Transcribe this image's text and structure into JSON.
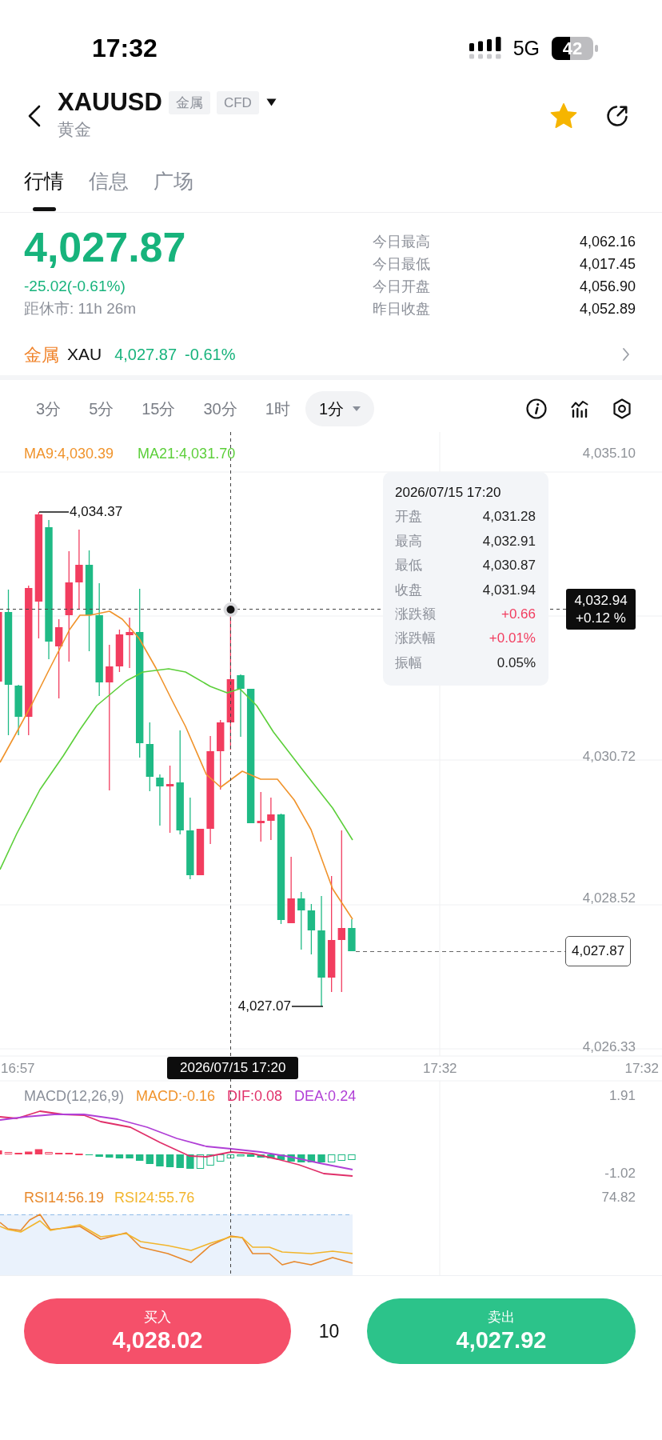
{
  "status_bar": {
    "time": "17:32",
    "network": "5G",
    "battery": "42"
  },
  "header": {
    "symbol": "XAUUSD",
    "tags": [
      "金属",
      "CFD"
    ],
    "name": "黄金",
    "favorite": true
  },
  "tabs": [
    {
      "label": "行情",
      "selected": true
    },
    {
      "label": "信息",
      "selected": false
    },
    {
      "label": "广场",
      "selected": false
    }
  ],
  "quote": {
    "price": "4,027.87",
    "change": "-25.02(-0.61%)",
    "rising": false,
    "countdown": "距休市: 11h 26m",
    "stats": [
      {
        "label": "今日最高",
        "value": "4,062.16"
      },
      {
        "label": "今日最低",
        "value": "4,017.45"
      },
      {
        "label": "今日开盘",
        "value": "4,056.90"
      },
      {
        "label": "昨日收盘",
        "value": "4,052.89"
      }
    ]
  },
  "sector": {
    "category": "金属",
    "symbol": "XAU",
    "price": "4,027.87",
    "change": "-0.61%",
    "rising": false
  },
  "intervals": [
    {
      "label": "3分",
      "selected": false
    },
    {
      "label": "5分",
      "selected": false
    },
    {
      "label": "15分",
      "selected": false
    },
    {
      "label": "30分",
      "selected": false
    },
    {
      "label": "1时",
      "selected": false
    },
    {
      "label": "1分",
      "selected": true
    }
  ],
  "chart": {
    "ma_legend": [
      {
        "label": "MA9:4,030.39",
        "color": "#f0932b"
      },
      {
        "label": "MA21:4,031.70",
        "color": "#5ccf3a"
      }
    ],
    "price_axis": [
      "4,035.10",
      "4,030.72",
      "4,028.52",
      "4,026.33"
    ],
    "high_label": "4,034.37",
    "low_label": "4,027.07",
    "last_price": "4,027.87",
    "crosshair": {
      "price": "4,032.94",
      "change": "+0.12 %",
      "time": "2026/07/15 17:20"
    },
    "tooltip": {
      "date": "2026/07/15 17:20",
      "rows": [
        {
          "label": "开盘",
          "value": "4,031.28",
          "color": "#222222"
        },
        {
          "label": "最高",
          "value": "4,032.91",
          "color": "#222222"
        },
        {
          "label": "最低",
          "value": "4,030.87",
          "color": "#222222"
        },
        {
          "label": "收盘",
          "value": "4,031.94",
          "color": "#222222"
        },
        {
          "label": "涨跌额",
          "value": "+0.66",
          "color": "#f23d5f"
        },
        {
          "label": "涨跌幅",
          "value": "+0.01%",
          "color": "#f23d5f"
        },
        {
          "label": "振幅",
          "value": "0.05%",
          "color": "#222222"
        }
      ]
    },
    "time_axis": [
      "16:57",
      "17:32",
      "17:32"
    ]
  },
  "macd": {
    "legend": [
      {
        "label": "MACD(12,26,9)",
        "color": "#8a8f99"
      },
      {
        "label": "MACD:-0.16",
        "color": "#f0932b"
      },
      {
        "label": "DIF:0.08",
        "color": "#e0306a"
      },
      {
        "label": "DEA:0.24",
        "color": "#b03fd6"
      }
    ],
    "axis": [
      "1.91",
      "-1.02"
    ]
  },
  "rsi": {
    "legend": [
      {
        "label": "RSI14:56.19",
        "color": "#e8892c"
      },
      {
        "label": "RSI24:55.76",
        "color": "#f2b52c"
      }
    ],
    "axis": [
      "74.82"
    ]
  },
  "trade": {
    "buy_label": "买入",
    "buy_price": "4,028.02",
    "quantity": "10",
    "sell_label": "卖出",
    "sell_price": "4,027.92"
  }
}
